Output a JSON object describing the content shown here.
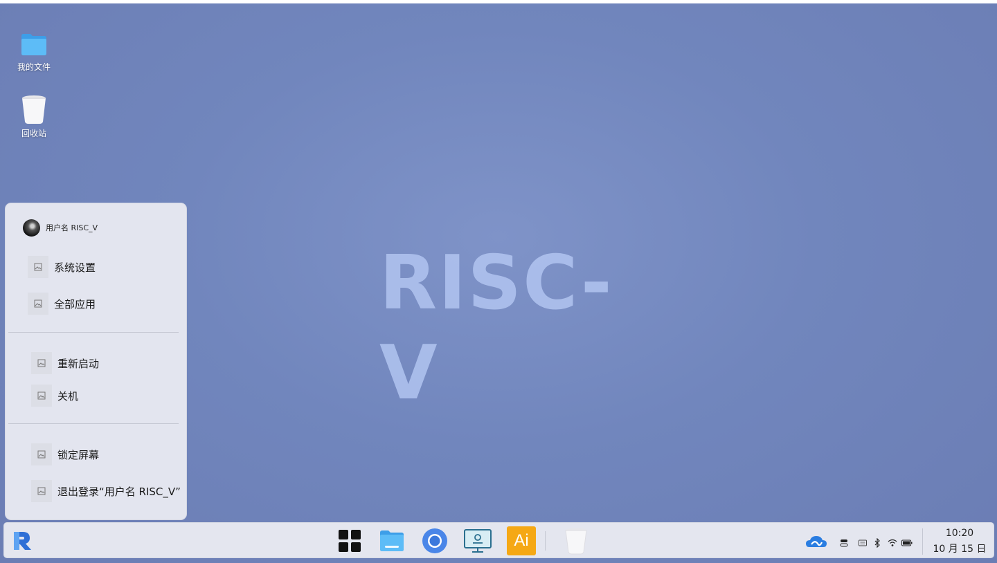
{
  "desktop": {
    "icons": [
      {
        "label": "我的文件",
        "icon": "folder-icon"
      },
      {
        "label": "回收站",
        "icon": "trash-icon"
      }
    ],
    "watermark": "RISC- V"
  },
  "start_menu": {
    "user": {
      "name": "用户名 RISC_V"
    },
    "items": [
      {
        "label": "系统设置",
        "icon": "image-placeholder-icon"
      },
      {
        "label": "全部应用",
        "icon": "image-placeholder-icon"
      },
      {
        "label": "重新启动",
        "icon": "image-placeholder-icon"
      },
      {
        "label": "关机",
        "icon": "image-placeholder-icon"
      },
      {
        "label": "锁定屏幕",
        "icon": "image-placeholder-icon"
      },
      {
        "label": "退出登录“用户名 RISC_V”",
        "icon": "image-placeholder-icon"
      }
    ]
  },
  "taskbar": {
    "start_logo": "R",
    "apps": [
      {
        "name": "app-grid",
        "icon": "grid-icon"
      },
      {
        "name": "files",
        "icon": "folder-icon"
      },
      {
        "name": "browser",
        "icon": "chromium-icon"
      },
      {
        "name": "remote-desktop",
        "icon": "monitor-icon"
      },
      {
        "name": "illustrator",
        "icon": "ai-icon",
        "label": "Ai"
      },
      {
        "name": "trash",
        "icon": "trash-icon"
      }
    ],
    "tray": [
      "cloud-sync-icon",
      "toggle-icon",
      "keyboard-icon",
      "bluetooth-icon",
      "wifi-icon",
      "battery-icon"
    ],
    "clock": {
      "time": "10:20",
      "date": "10 月 15 日"
    }
  },
  "colors": {
    "wallpaper": "#7186bd",
    "menu_bg": "#e3e5ef",
    "taskbar_bg": "#e4e6ef",
    "folder_blue": "#4db1f3",
    "ai_orange": "#f5a815"
  }
}
